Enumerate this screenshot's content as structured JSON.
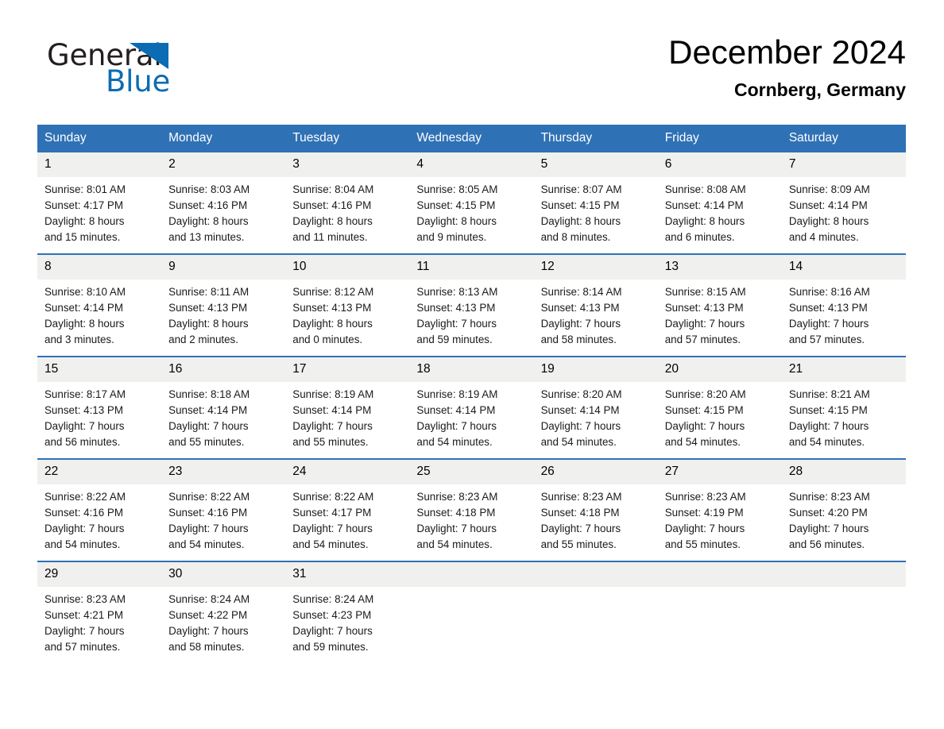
{
  "brand": {
    "name_part1": "General",
    "name_part2": "Blue",
    "accent_color": "#0b6cb3",
    "triangle_icon": "triangle-icon"
  },
  "header": {
    "title": "December 2024",
    "subtitle": "Cornberg, Germany"
  },
  "theme": {
    "header_blue": "#2f71b5",
    "daynum_gray": "#f0f0ee"
  },
  "weekday_headers": [
    "Sunday",
    "Monday",
    "Tuesday",
    "Wednesday",
    "Thursday",
    "Friday",
    "Saturday"
  ],
  "weeks": [
    [
      {
        "day": "1",
        "sunrise": "Sunrise: 8:01 AM",
        "sunset": "Sunset: 4:17 PM",
        "daylight_line1": "Daylight: 8 hours",
        "daylight_line2": "and 15 minutes."
      },
      {
        "day": "2",
        "sunrise": "Sunrise: 8:03 AM",
        "sunset": "Sunset: 4:16 PM",
        "daylight_line1": "Daylight: 8 hours",
        "daylight_line2": "and 13 minutes."
      },
      {
        "day": "3",
        "sunrise": "Sunrise: 8:04 AM",
        "sunset": "Sunset: 4:16 PM",
        "daylight_line1": "Daylight: 8 hours",
        "daylight_line2": "and 11 minutes."
      },
      {
        "day": "4",
        "sunrise": "Sunrise: 8:05 AM",
        "sunset": "Sunset: 4:15 PM",
        "daylight_line1": "Daylight: 8 hours",
        "daylight_line2": "and 9 minutes."
      },
      {
        "day": "5",
        "sunrise": "Sunrise: 8:07 AM",
        "sunset": "Sunset: 4:15 PM",
        "daylight_line1": "Daylight: 8 hours",
        "daylight_line2": "and 8 minutes."
      },
      {
        "day": "6",
        "sunrise": "Sunrise: 8:08 AM",
        "sunset": "Sunset: 4:14 PM",
        "daylight_line1": "Daylight: 8 hours",
        "daylight_line2": "and 6 minutes."
      },
      {
        "day": "7",
        "sunrise": "Sunrise: 8:09 AM",
        "sunset": "Sunset: 4:14 PM",
        "daylight_line1": "Daylight: 8 hours",
        "daylight_line2": "and 4 minutes."
      }
    ],
    [
      {
        "day": "8",
        "sunrise": "Sunrise: 8:10 AM",
        "sunset": "Sunset: 4:14 PM",
        "daylight_line1": "Daylight: 8 hours",
        "daylight_line2": "and 3 minutes."
      },
      {
        "day": "9",
        "sunrise": "Sunrise: 8:11 AM",
        "sunset": "Sunset: 4:13 PM",
        "daylight_line1": "Daylight: 8 hours",
        "daylight_line2": "and 2 minutes."
      },
      {
        "day": "10",
        "sunrise": "Sunrise: 8:12 AM",
        "sunset": "Sunset: 4:13 PM",
        "daylight_line1": "Daylight: 8 hours",
        "daylight_line2": "and 0 minutes."
      },
      {
        "day": "11",
        "sunrise": "Sunrise: 8:13 AM",
        "sunset": "Sunset: 4:13 PM",
        "daylight_line1": "Daylight: 7 hours",
        "daylight_line2": "and 59 minutes."
      },
      {
        "day": "12",
        "sunrise": "Sunrise: 8:14 AM",
        "sunset": "Sunset: 4:13 PM",
        "daylight_line1": "Daylight: 7 hours",
        "daylight_line2": "and 58 minutes."
      },
      {
        "day": "13",
        "sunrise": "Sunrise: 8:15 AM",
        "sunset": "Sunset: 4:13 PM",
        "daylight_line1": "Daylight: 7 hours",
        "daylight_line2": "and 57 minutes."
      },
      {
        "day": "14",
        "sunrise": "Sunrise: 8:16 AM",
        "sunset": "Sunset: 4:13 PM",
        "daylight_line1": "Daylight: 7 hours",
        "daylight_line2": "and 57 minutes."
      }
    ],
    [
      {
        "day": "15",
        "sunrise": "Sunrise: 8:17 AM",
        "sunset": "Sunset: 4:13 PM",
        "daylight_line1": "Daylight: 7 hours",
        "daylight_line2": "and 56 minutes."
      },
      {
        "day": "16",
        "sunrise": "Sunrise: 8:18 AM",
        "sunset": "Sunset: 4:14 PM",
        "daylight_line1": "Daylight: 7 hours",
        "daylight_line2": "and 55 minutes."
      },
      {
        "day": "17",
        "sunrise": "Sunrise: 8:19 AM",
        "sunset": "Sunset: 4:14 PM",
        "daylight_line1": "Daylight: 7 hours",
        "daylight_line2": "and 55 minutes."
      },
      {
        "day": "18",
        "sunrise": "Sunrise: 8:19 AM",
        "sunset": "Sunset: 4:14 PM",
        "daylight_line1": "Daylight: 7 hours",
        "daylight_line2": "and 54 minutes."
      },
      {
        "day": "19",
        "sunrise": "Sunrise: 8:20 AM",
        "sunset": "Sunset: 4:14 PM",
        "daylight_line1": "Daylight: 7 hours",
        "daylight_line2": "and 54 minutes."
      },
      {
        "day": "20",
        "sunrise": "Sunrise: 8:20 AM",
        "sunset": "Sunset: 4:15 PM",
        "daylight_line1": "Daylight: 7 hours",
        "daylight_line2": "and 54 minutes."
      },
      {
        "day": "21",
        "sunrise": "Sunrise: 8:21 AM",
        "sunset": "Sunset: 4:15 PM",
        "daylight_line1": "Daylight: 7 hours",
        "daylight_line2": "and 54 minutes."
      }
    ],
    [
      {
        "day": "22",
        "sunrise": "Sunrise: 8:22 AM",
        "sunset": "Sunset: 4:16 PM",
        "daylight_line1": "Daylight: 7 hours",
        "daylight_line2": "and 54 minutes."
      },
      {
        "day": "23",
        "sunrise": "Sunrise: 8:22 AM",
        "sunset": "Sunset: 4:16 PM",
        "daylight_line1": "Daylight: 7 hours",
        "daylight_line2": "and 54 minutes."
      },
      {
        "day": "24",
        "sunrise": "Sunrise: 8:22 AM",
        "sunset": "Sunset: 4:17 PM",
        "daylight_line1": "Daylight: 7 hours",
        "daylight_line2": "and 54 minutes."
      },
      {
        "day": "25",
        "sunrise": "Sunrise: 8:23 AM",
        "sunset": "Sunset: 4:18 PM",
        "daylight_line1": "Daylight: 7 hours",
        "daylight_line2": "and 54 minutes."
      },
      {
        "day": "26",
        "sunrise": "Sunrise: 8:23 AM",
        "sunset": "Sunset: 4:18 PM",
        "daylight_line1": "Daylight: 7 hours",
        "daylight_line2": "and 55 minutes."
      },
      {
        "day": "27",
        "sunrise": "Sunrise: 8:23 AM",
        "sunset": "Sunset: 4:19 PM",
        "daylight_line1": "Daylight: 7 hours",
        "daylight_line2": "and 55 minutes."
      },
      {
        "day": "28",
        "sunrise": "Sunrise: 8:23 AM",
        "sunset": "Sunset: 4:20 PM",
        "daylight_line1": "Daylight: 7 hours",
        "daylight_line2": "and 56 minutes."
      }
    ],
    [
      {
        "day": "29",
        "sunrise": "Sunrise: 8:23 AM",
        "sunset": "Sunset: 4:21 PM",
        "daylight_line1": "Daylight: 7 hours",
        "daylight_line2": "and 57 minutes."
      },
      {
        "day": "30",
        "sunrise": "Sunrise: 8:24 AM",
        "sunset": "Sunset: 4:22 PM",
        "daylight_line1": "Daylight: 7 hours",
        "daylight_line2": "and 58 minutes."
      },
      {
        "day": "31",
        "sunrise": "Sunrise: 8:24 AM",
        "sunset": "Sunset: 4:23 PM",
        "daylight_line1": "Daylight: 7 hours",
        "daylight_line2": "and 59 minutes."
      },
      {
        "day": "",
        "sunrise": "",
        "sunset": "",
        "daylight_line1": "",
        "daylight_line2": ""
      },
      {
        "day": "",
        "sunrise": "",
        "sunset": "",
        "daylight_line1": "",
        "daylight_line2": ""
      },
      {
        "day": "",
        "sunrise": "",
        "sunset": "",
        "daylight_line1": "",
        "daylight_line2": ""
      },
      {
        "day": "",
        "sunrise": "",
        "sunset": "",
        "daylight_line1": "",
        "daylight_line2": ""
      }
    ]
  ]
}
